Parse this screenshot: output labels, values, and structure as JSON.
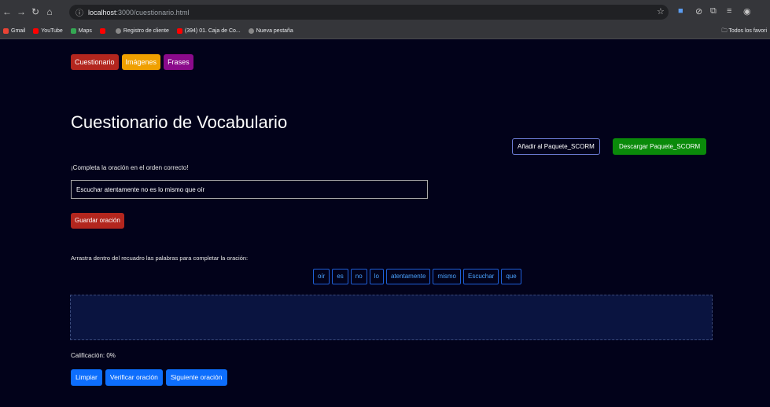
{
  "browser": {
    "url_host": "localhost",
    "url_path": ":3000/cuestionario.html",
    "bookmarks": [
      {
        "label": "Gmail",
        "color": "#ea4335"
      },
      {
        "label": "YouTube",
        "color": "#ff0000"
      },
      {
        "label": "Maps",
        "color": "#34a853"
      },
      {
        "label": "",
        "color": "#ff0000"
      },
      {
        "label": "Registro de cliente",
        "color": "#888888"
      },
      {
        "label": "(394) 01. Caja de Co...",
        "color": "#ff0000"
      },
      {
        "label": "Nueva pestaña",
        "color": "#888888"
      }
    ],
    "all_bookmarks": "Todos los favori"
  },
  "tabs": {
    "cuestionario": "Cuestionario",
    "imagenes": "Imágenes",
    "frases": "Frases"
  },
  "title": "Cuestionario de Vocabulario",
  "actions": {
    "add_scorm": "Añadir al Paquete_SCORM",
    "download_scorm": "Descargar Paquete_SCORM"
  },
  "instruction": "¡Completa la oración en el orden correcto!",
  "sentence_value": "Escuchar atentamente no es lo mismo que oír",
  "save_label": "Guardar oración",
  "drag_instruction": "Arrastra dentro del recuadro las palabras para completar la oración:",
  "words": [
    "oír",
    "es",
    "no",
    "lo",
    "atentamente",
    "mismo",
    "Escuchar",
    "que"
  ],
  "grade": "Calificación: 0%",
  "bottom_buttons": {
    "clear": "Limpiar",
    "verify": "Verificar oración",
    "next": "Siguiente oración"
  },
  "colors": {
    "background": "#02021a",
    "danger": "#b3261e",
    "warning": "#f0a000",
    "purple": "#8b0a8b",
    "success": "#0a8a0a",
    "primary": "#0d6efd"
  }
}
